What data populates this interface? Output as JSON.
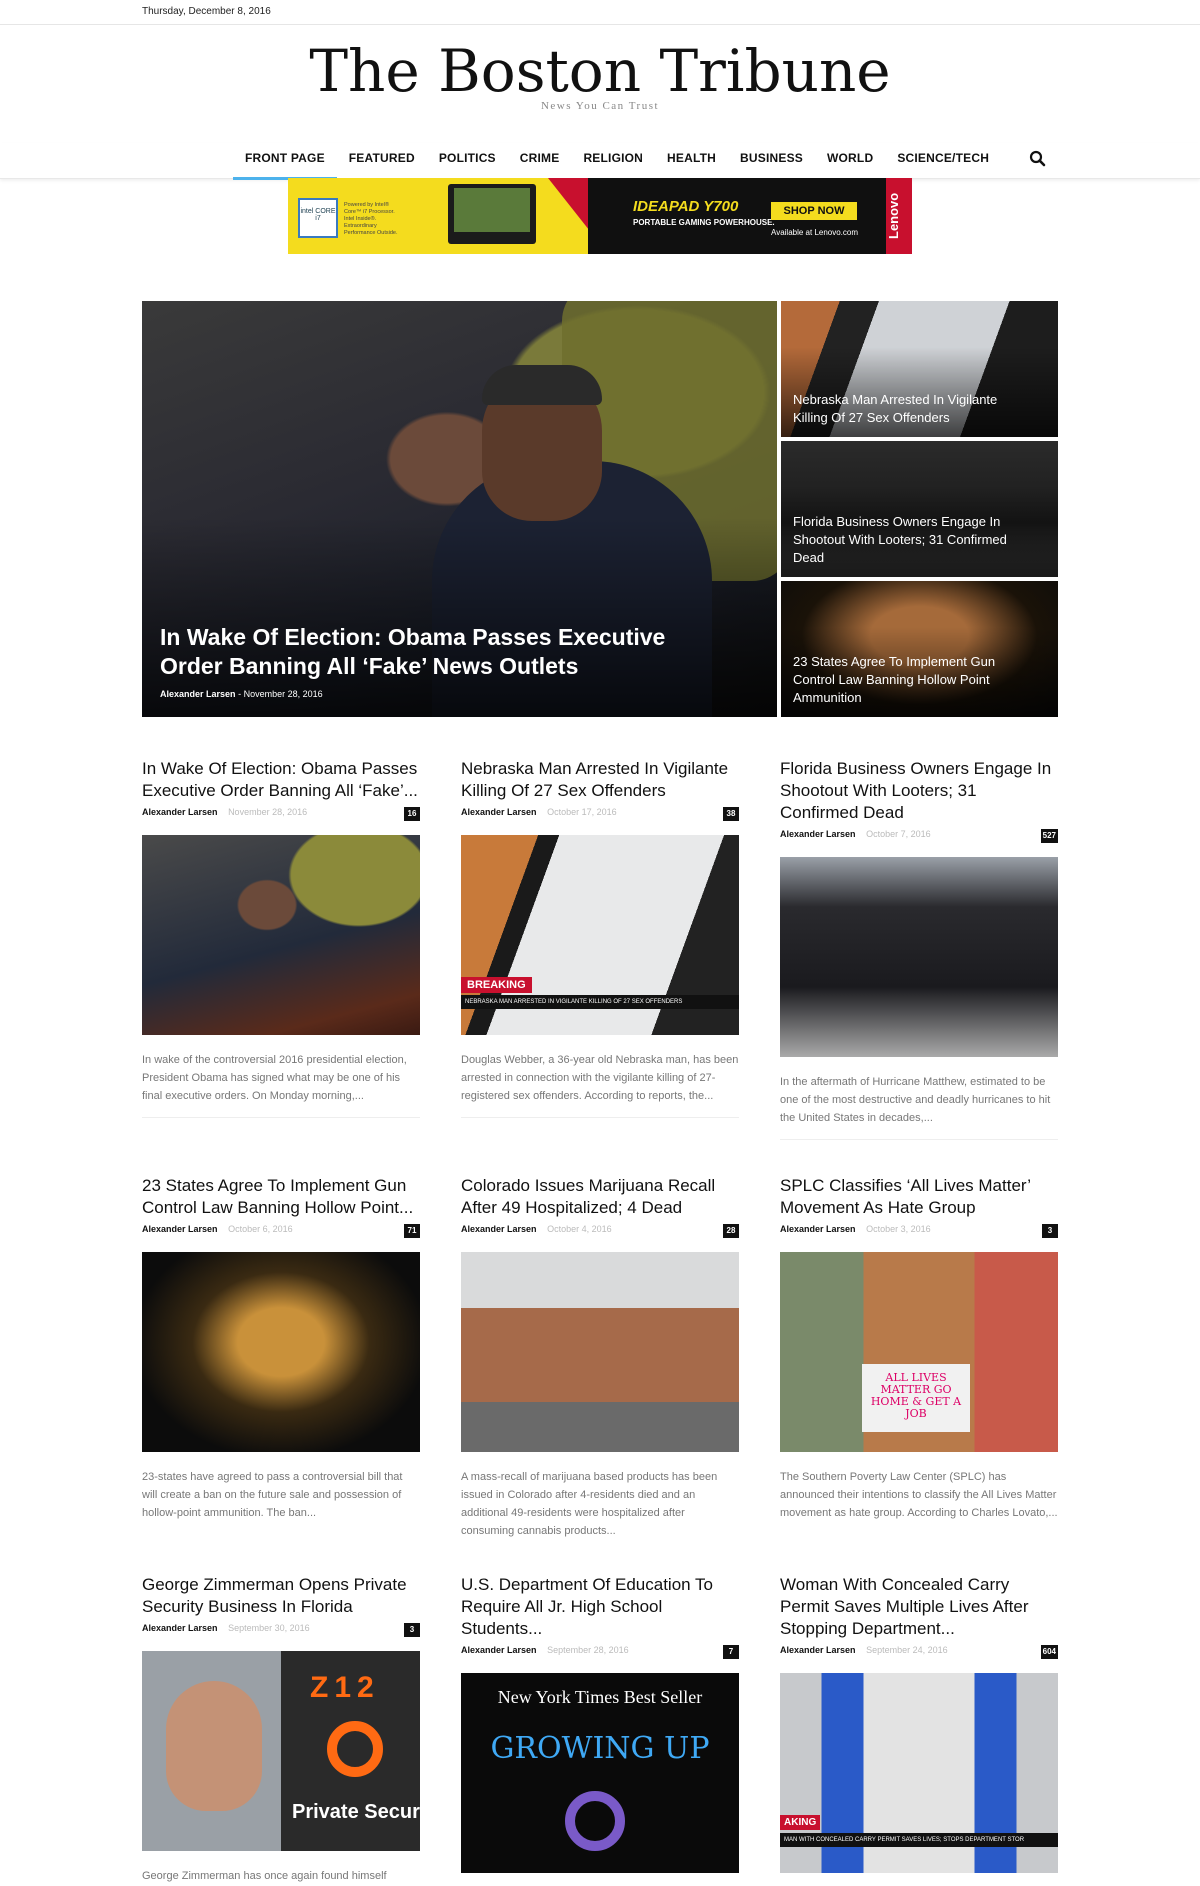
{
  "topbar": {
    "date": "Thursday, December 8, 2016"
  },
  "header": {
    "title": "The Boston Tribune",
    "tagline": "News You Can Trust"
  },
  "nav": {
    "items": [
      "FRONT PAGE",
      "FEATURED",
      "POLITICS",
      "CRIME",
      "RELIGION",
      "HEALTH",
      "BUSINESS",
      "WORLD",
      "SCIENCE/TECH"
    ],
    "active": "FRONT PAGE",
    "search_icon": "search-icon"
  },
  "ad": {
    "intel_label": "intel CORE i7",
    "intel_copy": "Powered by Intel® Core™ i7 Processor. Intel Inside®. Extraordinary Performance Outside.",
    "model": "IDEAPAD Y700",
    "sub": "PORTABLE GAMING POWERHOUSE.",
    "cta": "SHOP NOW",
    "availability": "Available at Lenovo.com",
    "brand": "Lenovo"
  },
  "hero": {
    "main": {
      "headline": "In Wake Of Election: Obama Passes Executive Order Banning All ‘Fake’ News Outlets",
      "author": "Alexander Larsen",
      "separator": "-",
      "date": "November 28, 2016"
    },
    "side": [
      {
        "headline": "Nebraska Man Arrested In Vigilante Killing Of 27 Sex Offenders"
      },
      {
        "headline": "Florida Business Owners Engage In Shootout With Looters; 31 Confirmed Dead"
      },
      {
        "headline": "23 States Agree To Implement Gun Control Law Banning Hollow Point Ammunition"
      }
    ]
  },
  "articles": [
    {
      "title": "In Wake Of Election: Obama Passes Executive Order Banning All ‘Fake’...",
      "author": "Alexander Larsen",
      "date": "November 28, 2016",
      "count": "16",
      "excerpt": "In wake of the controversial 2016 presidential election, President Obama has signed what may be one of his final executive orders. On Monday morning,..."
    },
    {
      "title": "Nebraska Man Arrested In Vigilante Killing Of 27 Sex Offenders",
      "author": "Alexander Larsen",
      "date": "October 17, 2016",
      "count": "38",
      "excerpt": "Douglas Webber, a 36-year old Nebraska man, has been arrested in connection with the vigilante killing of 27-registered sex offenders. According to reports, the...",
      "breaking": "BREAKING",
      "ticker": "NEBRASKA MAN ARRESTED IN VIGILANTE KILLING OF 27 SEX OFFENDERS"
    },
    {
      "title": "Florida Business Owners Engage In Shootout With Looters; 31 Confirmed Dead",
      "author": "Alexander Larsen",
      "date": "October 7, 2016",
      "count": "527",
      "excerpt": "In the aftermath of Hurricane Matthew, estimated to be one of the most destructive and deadly hurricanes to hit the United States in decades,..."
    },
    {
      "title": "23 States Agree To Implement Gun Control Law Banning Hollow Point...",
      "author": "Alexander Larsen",
      "date": "October 6, 2016",
      "count": "71",
      "excerpt": "23-states have agreed to pass a controversial bill that will create a ban on the future sale and possession of hollow-point ammunition. The ban..."
    },
    {
      "title": "Colorado Issues Marijuana Recall After 49 Hospitalized; 4 Dead",
      "author": "Alexander Larsen",
      "date": "October 4, 2016",
      "count": "28",
      "excerpt": "A mass-recall of marijuana based products has been issued in Colorado after 4-residents died and an additional 49-residents were hospitalized after consuming cannabis products..."
    },
    {
      "title": "SPLC Classifies ‘All Lives Matter’ Movement As Hate Group",
      "author": "Alexander Larsen",
      "date": "October 3, 2016",
      "count": "3",
      "excerpt": "The Southern Poverty Law Center (SPLC) has announced their intentions to classify the All Lives Matter movement as hate group. According to Charles Lovato,...",
      "sign": "ALL LIVES MATTER GO HOME & GET A JOB"
    },
    {
      "title": "George Zimmerman Opens Private Security Business In Florida",
      "author": "Alexander Larsen",
      "date": "September 30, 2016",
      "count": "3",
      "excerpt": "George Zimmerman has once again found himself",
      "logo_digits": "Z12",
      "logo_text": "Private Securi"
    },
    {
      "title": "U.S. Department Of Education To Require All Jr. High School Students...",
      "author": "Alexander Larsen",
      "date": "September 28, 2016",
      "count": "7",
      "excerpt": "",
      "book_top": "New York Times Best Seller",
      "book_title": "GROWING UP"
    },
    {
      "title": "Woman With Concealed Carry Permit Saves Multiple Lives After Stopping Department...",
      "author": "Alexander Larsen",
      "date": "September 24, 2016",
      "count": "604",
      "excerpt": "",
      "breaking": "AKING",
      "ticker": "MAN WITH CONCEALED CARRY PERMIT SAVES LIVES; STOPS DEPARTMENT STOR"
    }
  ]
}
